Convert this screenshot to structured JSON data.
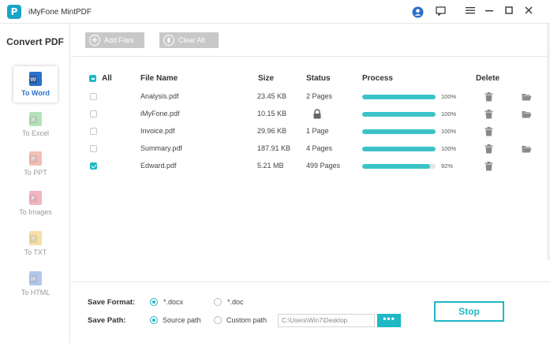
{
  "window": {
    "title": "iMyFone MintPDF",
    "logo_letter": "P"
  },
  "sidebar": {
    "title": "Convert PDF",
    "items": [
      {
        "label": "To Word",
        "badge": "W",
        "color": "#2b70c9",
        "active": true
      },
      {
        "label": "To Excel",
        "badge": "X",
        "color": "#5fbf6b",
        "active": false
      },
      {
        "label": "To PPT",
        "badge": "P",
        "color": "#e6735a",
        "active": false
      },
      {
        "label": "To Images",
        "badge": "P",
        "color": "#e85d75",
        "active": false
      },
      {
        "label": "To TXT",
        "badge": "T",
        "color": "#e9b93f",
        "active": false
      },
      {
        "label": "To HTML",
        "badge": "H",
        "color": "#5b83d6",
        "active": false
      }
    ]
  },
  "toolbar": {
    "add_files": "Add Files",
    "clear_all": "Clear All"
  },
  "table": {
    "headers": {
      "all": "All",
      "file_name": "File Name",
      "size": "Size",
      "status": "Status",
      "process": "Process",
      "delete": "Delete"
    },
    "rows": [
      {
        "name": "Analysis.pdf",
        "size": "23.45 KB",
        "status": "2 Pages",
        "locked": false,
        "progress": 100,
        "progress_text": "100%",
        "checked": false,
        "folder": true
      },
      {
        "name": "iMyFone.pdf",
        "size": "10.15 KB",
        "status": "",
        "locked": true,
        "progress": 100,
        "progress_text": "100%",
        "checked": false,
        "folder": true
      },
      {
        "name": "Invoice.pdf",
        "size": "29.96 KB",
        "status": "1 Page",
        "locked": false,
        "progress": 100,
        "progress_text": "100%",
        "checked": false,
        "folder": false
      },
      {
        "name": "Summary.pdf",
        "size": "187.91 KB",
        "status": "4 Pages",
        "locked": false,
        "progress": 100,
        "progress_text": "100%",
        "checked": false,
        "folder": true
      },
      {
        "name": "Edward.pdf",
        "size": "5.21 MB",
        "status": "499 Pages",
        "locked": false,
        "progress": 92,
        "progress_text": "92%",
        "checked": true,
        "folder": false
      }
    ]
  },
  "bottom": {
    "save_format_label": "Save Format:",
    "format_docx": "*.docx",
    "format_doc": "*.doc",
    "save_path_label": "Save Path:",
    "source_path": "Source path",
    "custom_path": "Custom path",
    "path_value": "C:\\Users\\Win7\\Desktop",
    "browse": "•••",
    "stop": "Stop"
  },
  "colors": {
    "accent": "#1fb8c4",
    "progress": "#3cc3c8",
    "active_nav": "#2b70c9"
  }
}
